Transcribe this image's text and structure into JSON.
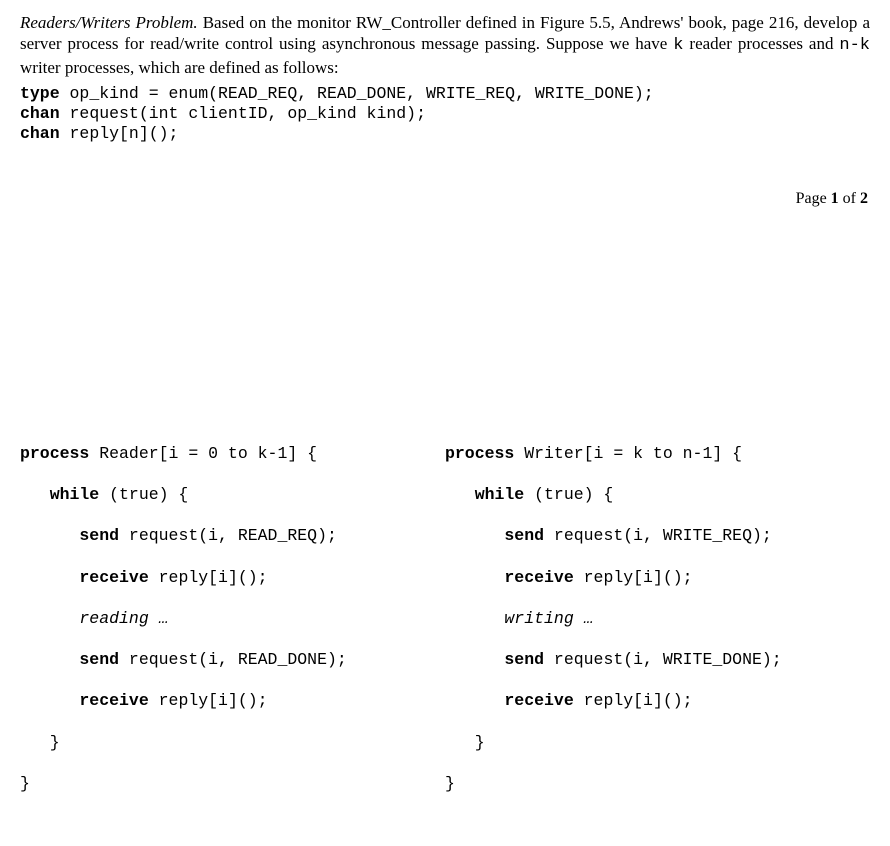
{
  "problem": {
    "title": "Readers/Writers Problem.",
    "body_before_k": " Based on the monitor RW_Controller defined in Figure 5.5, Andrews' book, page 216, develop a server process for read/write control using asynchronous message passing. Suppose we have ",
    "k": "k",
    "mid": " reader processes and ",
    "nk": "n-k",
    "after": " writer processes, which are defined as follows:"
  },
  "decl": {
    "l1_kw": "type",
    "l1_rest": " op_kind = enum(READ_REQ, READ_DONE, WRITE_REQ, WRITE_DONE);",
    "l2_kw": "chan",
    "l2_rest": " request(int clientID, op_kind kind);",
    "l3_kw": "chan",
    "l3_rest": " reply[n]();"
  },
  "page_indicator": {
    "prefix": "Page ",
    "cur": "1",
    "mid": " of ",
    "total": "2"
  },
  "reader": {
    "l1a": "process",
    "l1b": " Reader[i = 0 to k-1] {",
    "l2a": "   while",
    "l2b": " (true) {",
    "l3a": "      send",
    "l3b": " request(i, READ_REQ);",
    "l4a": "      receive",
    "l4b": " reply[i]();",
    "l5": "      reading …",
    "l6a": "      send",
    "l6b": " request(i, READ_DONE);",
    "l7a": "      receive",
    "l7b": " reply[i]();",
    "l8": "   }",
    "l9": "}"
  },
  "writer": {
    "l1a": "process",
    "l1b": " Writer[i = k to n-1] {",
    "l2a": "   while",
    "l2b": " (true) {",
    "l3a": "      send",
    "l3b": " request(i, WRITE_REQ);",
    "l4a": "      receive",
    "l4b": " reply[i]();",
    "l5": "      writing …",
    "l6a": "      send",
    "l6b": " request(i, WRITE_DONE);",
    "l7a": "      receive",
    "l7b": " reply[i]();",
    "l8": "   }",
    "l9": "}"
  }
}
